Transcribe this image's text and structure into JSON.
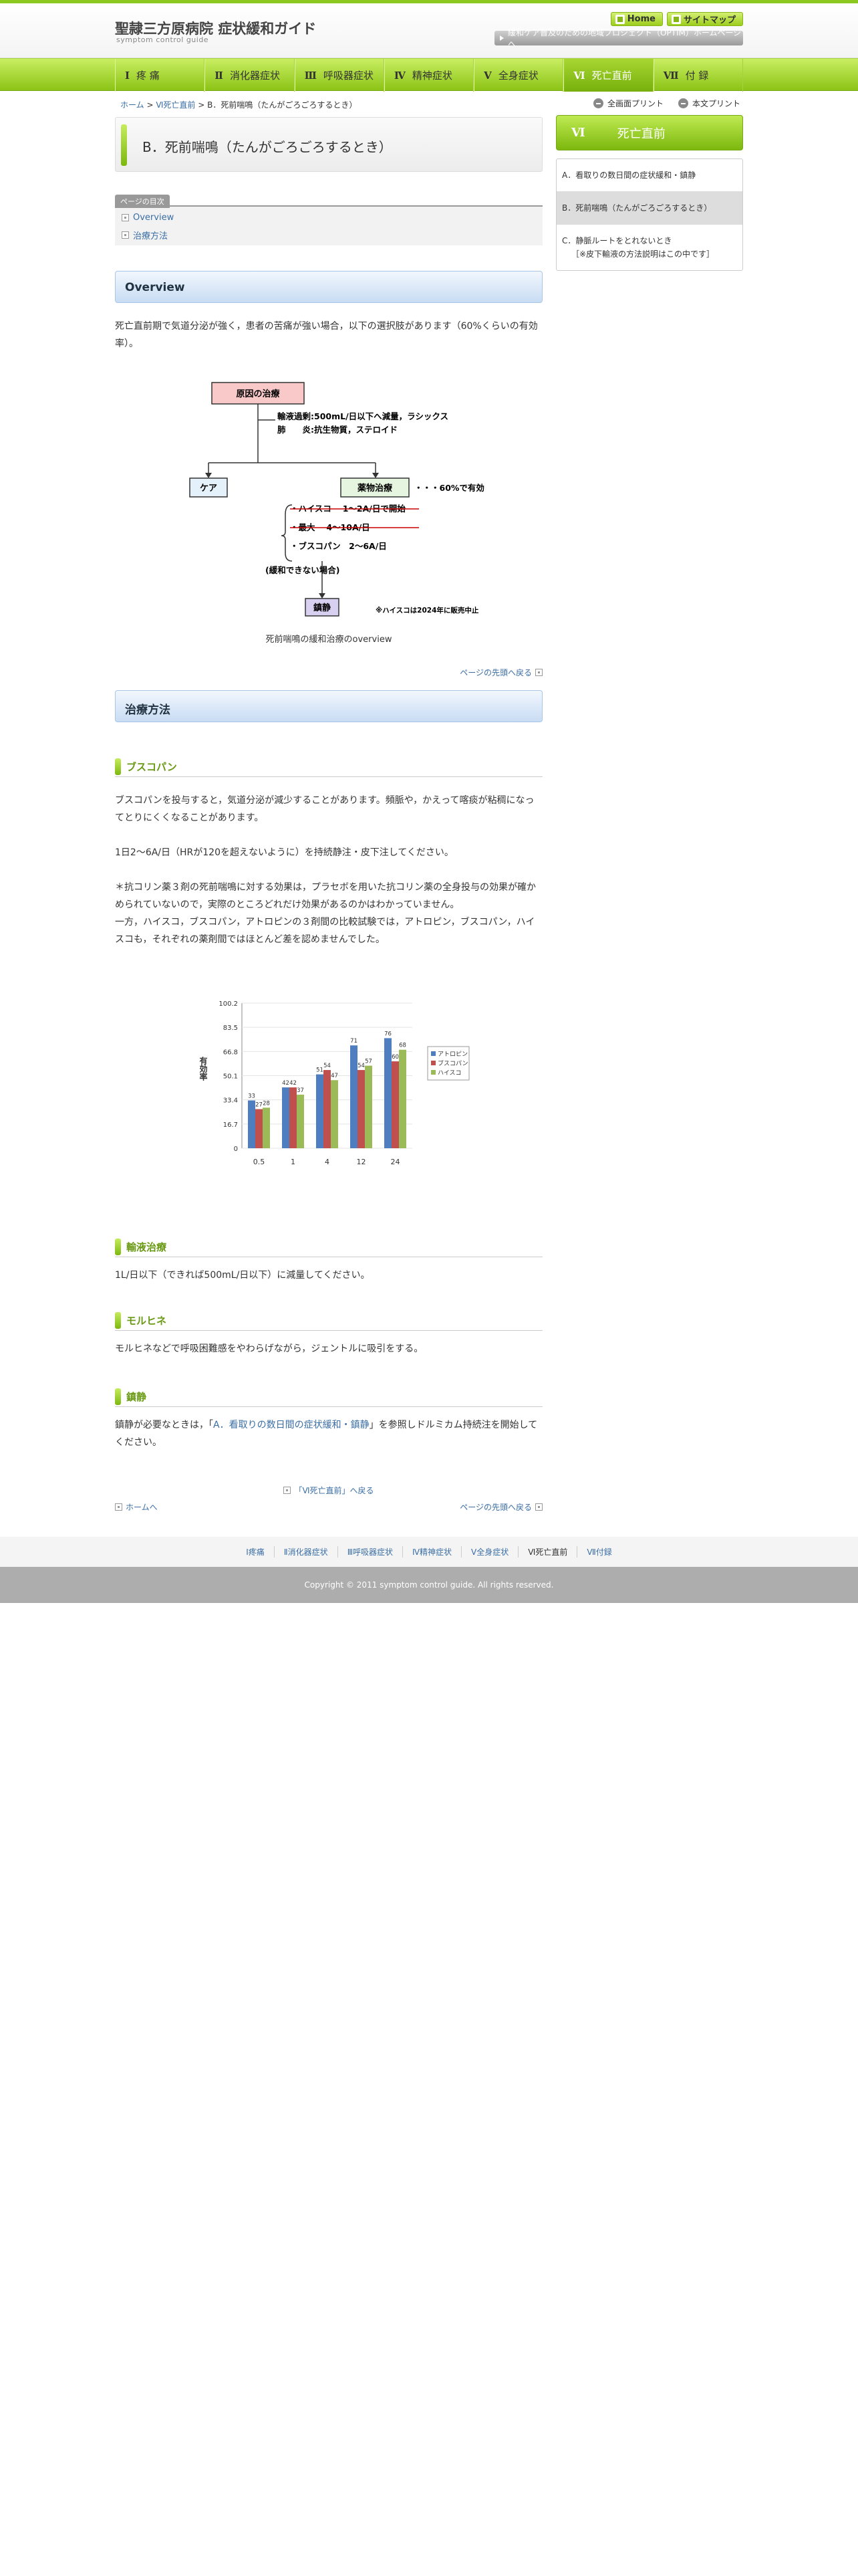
{
  "header": {
    "logo_title": "聖隷三方原病院 症状緩和ガイド",
    "logo_sub": "symptom control guide",
    "home_label": "Home",
    "sitemap_label": "サイトマップ",
    "project_link": "緩和ケア普及のための地域プロジェクト（OPTIM）ホームページへ"
  },
  "nav": [
    {
      "num": "Ⅰ",
      "label": "疼 痛"
    },
    {
      "num": "Ⅱ",
      "label": "消化器症状"
    },
    {
      "num": "Ⅲ",
      "label": "呼吸器症状"
    },
    {
      "num": "Ⅳ",
      "label": "精神症状"
    },
    {
      "num": "Ⅴ",
      "label": "全身症状"
    },
    {
      "num": "Ⅵ",
      "label": "死亡直前"
    },
    {
      "num": "Ⅶ",
      "label": "付 録"
    }
  ],
  "breadcrumb": {
    "home": "ホーム",
    "sep": ">",
    "parent": "Ⅵ死亡直前",
    "current": "B．死前喘鳴（たんがごろごろするとき）"
  },
  "print": {
    "full": "全画面プリント",
    "body": "本文プリント"
  },
  "page_title": "B．死前喘鳴（たんがごろごろするとき）",
  "toc": {
    "label": "ページの目次",
    "items": [
      "Overview",
      "治療方法"
    ]
  },
  "overview": {
    "heading": "Overview",
    "text": "死亡直前期で気道分泌が強く，患者の苦痛が強い場合，以下の選択肢があります（60%くらいの有効率）。",
    "diagram": {
      "box_cause": "原因の治療",
      "cause_line1": "輸液過剰:500mL/日以下へ減量，ラシックス",
      "cause_line2": "肺　　炎:抗生物質，ステロイド",
      "box_care": "ケア",
      "box_drug": "薬物治療",
      "drug_note": "・・・60%で有効",
      "drug1": "・ハイスコ　 1～2A/日で開始",
      "drug2": "・最大　 4～10A/日",
      "drug3": "・ブスコパン　2～6A/日",
      "fail": "(緩和できない場合)",
      "box_sed": "鎮静",
      "note": "※ハイスコは2024年に販売中止"
    },
    "caption": "死前喘鳴の緩和治療のoverview",
    "totop": "ページの先頭へ戻る"
  },
  "treatment": {
    "heading": "治療方法",
    "buscopan": {
      "title": "ブスコパン",
      "p1": "ブスコパンを投与すると，気道分泌が減少することがあります。頻脈や，かえって喀痰が粘稠になってとりにくくなることがあります。",
      "p2": "1日2～6A/日（HRが120を超えないように）を持続静注・皮下注してください。",
      "p3": "＊抗コリン薬３剤の死前喘鳴に対する効果は，プラセボを用いた抗コリン薬の全身投与の効果が確かめられていないので，実際のところどれだけ効果があるのかはわかっていません。",
      "p4": "一方，ハイスコ，ブスコパン，アトロピンの３剤間の比較試験では，アトロピン，ブスコパン，ハイスコも，それぞれの薬剤間ではほとんど差を認めませんでした。"
    },
    "infusion": {
      "title": "輸液治療",
      "text": "1L/日以下（できれば500mL/日以下）に減量してください。"
    },
    "morphine": {
      "title": "モルヒネ",
      "text": "モルヒネなどで呼吸困難感をやわらげながら，ジェントルに吸引をする。"
    },
    "sedation": {
      "title": "鎮静",
      "text_before": "鎮静が必要なときは，「",
      "link": "A．看取りの数日間の症状緩和・鎮静",
      "text_after": "」を参照しドルミカム持続注を開始してください。"
    }
  },
  "back_link": "「Ⅵ死亡直前」へ戻る",
  "home_link": "ホームへ",
  "totop2": "ページの先頭へ戻る",
  "side": {
    "num": "Ⅵ",
    "title": "死亡直前",
    "items": [
      "A．看取りの数日間の症状緩和・鎮静",
      "B．死前喘鳴（たんがごろごろするとき）",
      "C．静脈ルートをとれないとき",
      "［※皮下輸液の方法説明はこの中です］"
    ]
  },
  "footer": {
    "links": [
      "Ⅰ疼痛",
      "Ⅱ消化器症状",
      "Ⅲ呼吸器症状",
      "Ⅳ精神症状",
      "Ⅴ全身症状",
      "Ⅵ死亡直前",
      "Ⅶ付録"
    ],
    "copyright": "Copyright © 2011 symptom control guide. All rights reserved."
  },
  "colors": {
    "accent_green": "#8cc416",
    "link_blue": "#3a6ea5",
    "series_atropine": "#4f7ec0",
    "series_buscopan": "#c0504d",
    "series_hysco": "#9bbb59"
  },
  "chart_data": {
    "type": "bar",
    "ylabel": "有効率",
    "categories": [
      "0.5",
      "1",
      "4",
      "12",
      "24"
    ],
    "ylim": [
      0,
      100.2
    ],
    "yticks": [
      "0",
      "16.7",
      "33.4",
      "50.1",
      "66.8",
      "83.5",
      "100.2"
    ],
    "legend_position": "right",
    "series": [
      {
        "name": "アトロピン",
        "values": [
          33,
          42,
          51,
          71,
          76
        ]
      },
      {
        "name": "ブスコパン",
        "values": [
          27,
          42,
          54,
          54,
          60
        ]
      },
      {
        "name": "ハイスコ",
        "values": [
          28,
          37,
          47,
          57,
          68
        ]
      }
    ],
    "data_labels": [
      [
        "33",
        "42",
        "51",
        "71",
        "76"
      ],
      [
        "27",
        "42",
        "54",
        "54",
        "60"
      ],
      [
        "28",
        "37",
        "47",
        "57",
        "68"
      ]
    ]
  }
}
